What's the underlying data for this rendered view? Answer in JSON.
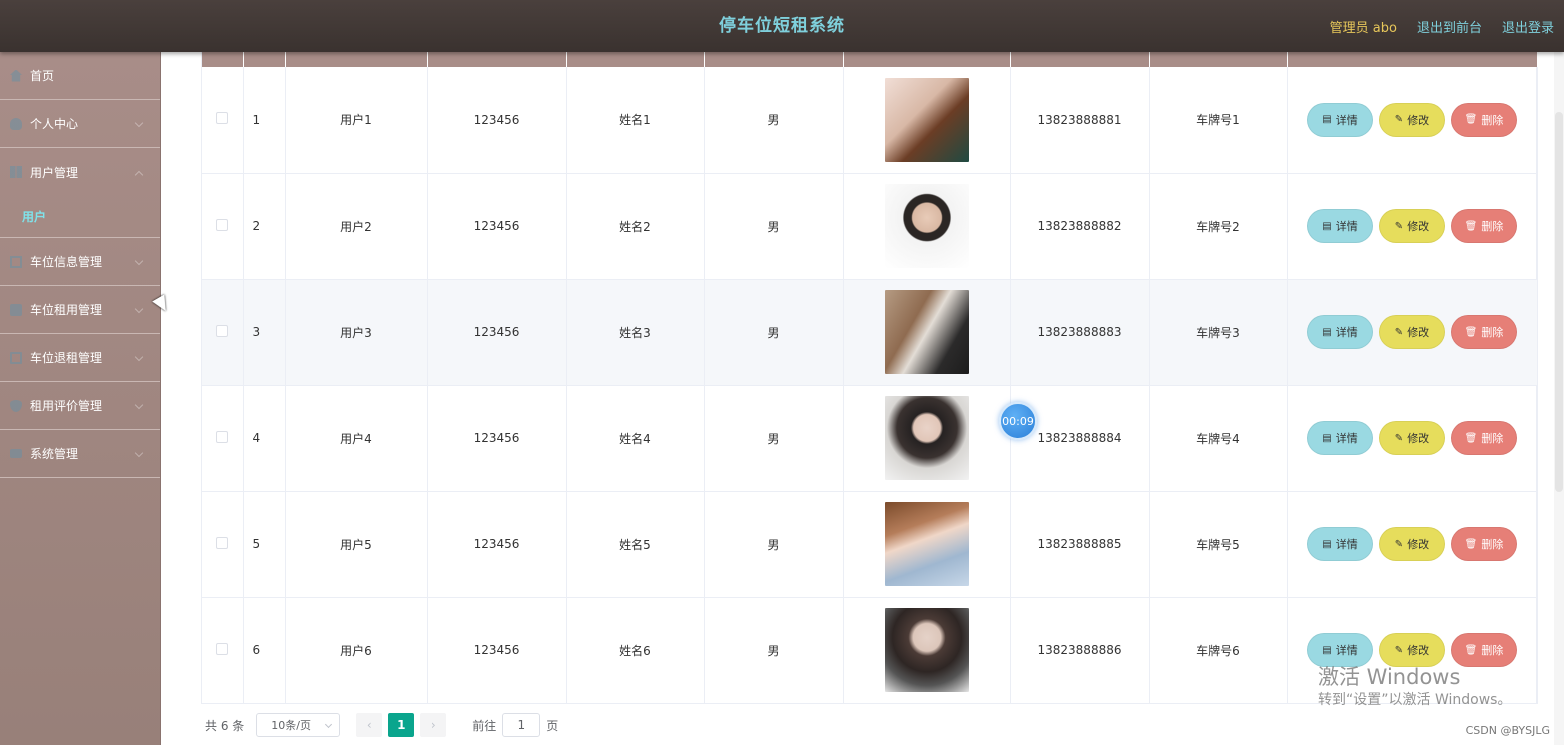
{
  "header": {
    "title": "停车位短租系统",
    "admin_label": "管理员 abo",
    "to_front_label": "退出到前台",
    "logout_label": "退出登录"
  },
  "sidebar": {
    "items": [
      {
        "label": "首页",
        "icon": "home-icon"
      },
      {
        "label": "个人中心",
        "icon": "user-icon"
      },
      {
        "label": "用户管理",
        "icon": "grid-icon"
      },
      {
        "label": "用户",
        "submenu": true
      },
      {
        "label": "车位信息管理",
        "icon": "box-icon"
      },
      {
        "label": "车位租用管理",
        "icon": "bag-icon"
      },
      {
        "label": "车位退租管理",
        "icon": "doc-icon"
      },
      {
        "label": "租用评价管理",
        "icon": "shield-icon"
      },
      {
        "label": "系统管理",
        "icon": "monitor-icon"
      }
    ]
  },
  "table": {
    "rows": [
      {
        "index": "1",
        "account": "用户1",
        "password": "123456",
        "name": "姓名1",
        "gender": "男",
        "phone": "13823888881",
        "plate": "车牌号1"
      },
      {
        "index": "2",
        "account": "用户2",
        "password": "123456",
        "name": "姓名2",
        "gender": "男",
        "phone": "13823888882",
        "plate": "车牌号2"
      },
      {
        "index": "3",
        "account": "用户3",
        "password": "123456",
        "name": "姓名3",
        "gender": "男",
        "phone": "13823888883",
        "plate": "车牌号3"
      },
      {
        "index": "4",
        "account": "用户4",
        "password": "123456",
        "name": "姓名4",
        "gender": "男",
        "phone": "13823888884",
        "plate": "车牌号4"
      },
      {
        "index": "5",
        "account": "用户5",
        "password": "123456",
        "name": "姓名5",
        "gender": "男",
        "phone": "13823888885",
        "plate": "车牌号5"
      },
      {
        "index": "6",
        "account": "用户6",
        "password": "123456",
        "name": "姓名6",
        "gender": "男",
        "phone": "13823888886",
        "plate": "车牌号6"
      }
    ],
    "actions": {
      "detail_label": "详情",
      "edit_label": "修改",
      "delete_label": "删除"
    }
  },
  "pagination": {
    "total_text": "共 6 条",
    "page_size": "10条/页",
    "current_page": "1",
    "goto_label": "前往",
    "goto_value": "1",
    "page_unit": "页"
  },
  "overlay": {
    "timer": "00:09",
    "watermark_line1": "激活 Windows",
    "watermark_line2": "转到“设置”以激活 Windows。",
    "credit": "CSDN @BYSJLG"
  },
  "colors": {
    "header_bg": "#3f3633",
    "title_color": "#7fd0dc",
    "sidebar_bg": "#a88d88",
    "active_submenu": "#7fe3ea",
    "page_active": "#0aa58d",
    "btn_detail": "#9ad9e2",
    "btn_edit": "#e6dd5c",
    "btn_delete": "#e67f77"
  }
}
